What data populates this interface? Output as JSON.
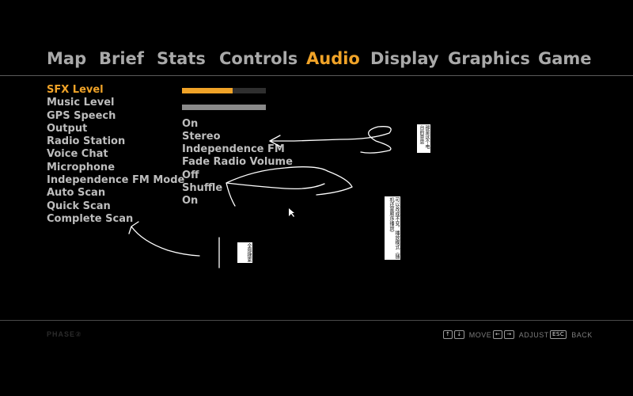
{
  "tabs": [
    "Map",
    "Brief",
    "Stats",
    "Controls",
    "Audio",
    "Display",
    "Graphics",
    "Game"
  ],
  "active_tab": "Audio",
  "settings": [
    {
      "label": "SFX Level",
      "type": "bar",
      "level": 0.6,
      "fill_color": "#f0a328"
    },
    {
      "label": "Music Level",
      "type": "bar",
      "level": 1.0,
      "fill_color": "#8a8a8a"
    },
    {
      "label": "GPS Speech",
      "type": "text",
      "value": "On"
    },
    {
      "label": "Output",
      "type": "text",
      "value": "Stereo"
    },
    {
      "label": "Radio Station",
      "type": "text",
      "value": "Independence FM"
    },
    {
      "label": "Voice Chat",
      "type": "text",
      "value": "Fade Radio Volume"
    },
    {
      "label": "Microphone",
      "type": "text",
      "value": "Off"
    },
    {
      "label": "Independence FM Mode",
      "type": "text",
      "value": "Shuffle"
    },
    {
      "label": "Auto Scan",
      "type": "text",
      "value": "On"
    },
    {
      "label": "Quick Scan",
      "type": "text",
      "value": ""
    },
    {
      "label": "Complete Scan",
      "type": "text",
      "value": ""
    }
  ],
  "controls": [
    {
      "keys": [
        "↑",
        "↓"
      ],
      "label": "MOVE"
    },
    {
      "keys": [
        "←",
        "→"
      ],
      "label": "ADJUST"
    },
    {
      "keys": [
        "ESC"
      ],
      "label": "BACK"
    }
  ],
  "logo": "PHASE②",
  "notes": {
    "note1": "那是这个电台的意思",
    "note2": "可以改成不变，播放模式（随机还是顺序播放）",
    "note3": "全部搜索"
  },
  "colors": {
    "accent": "#f0a328",
    "inactive": "#a9a9a9",
    "label": "#bdbdbd"
  }
}
